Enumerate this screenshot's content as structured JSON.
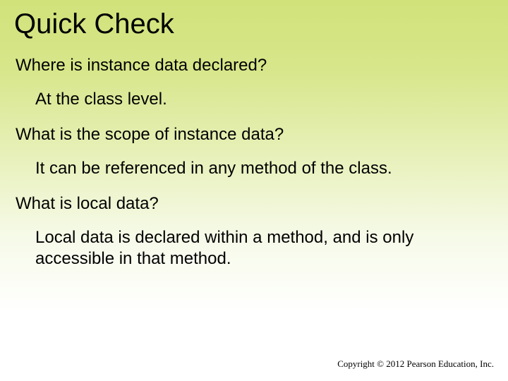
{
  "title": "Quick Check",
  "qa": [
    {
      "question": "Where is instance data declared?",
      "answer": "At the class level."
    },
    {
      "question": "What is the scope of instance data?",
      "answer": "It can be referenced in any method of the class."
    },
    {
      "question": "What is local data?",
      "answer": "Local data is declared within a method, and is only accessible in that method."
    }
  ],
  "copyright": "Copyright © 2012 Pearson Education, Inc."
}
